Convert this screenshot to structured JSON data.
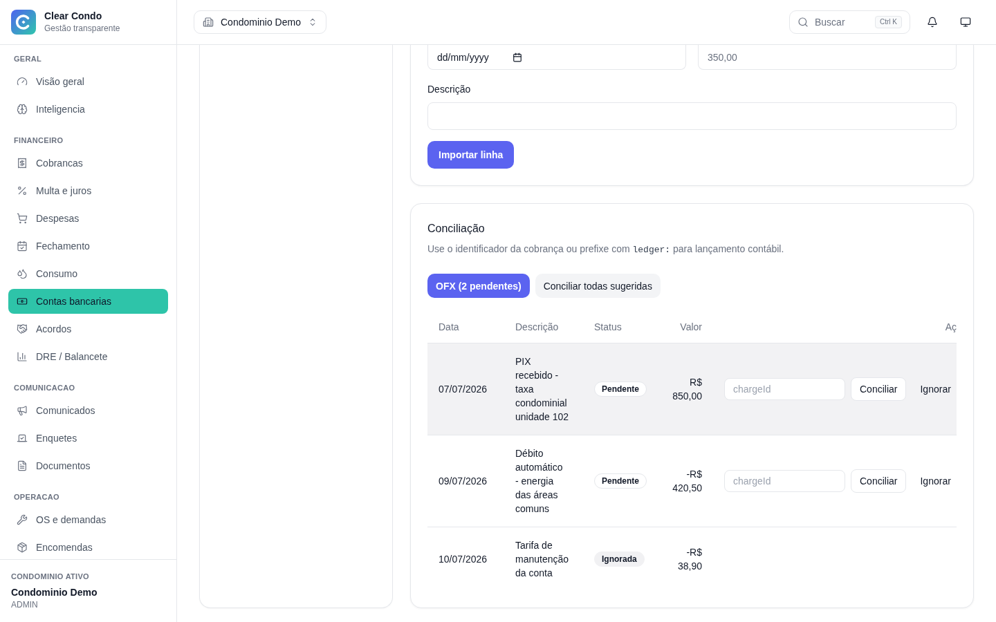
{
  "sidebar": {
    "brand": {
      "name": "Clear Condo",
      "tagline": "Gestão transparente"
    },
    "sections": [
      {
        "title": "GERAL",
        "items": [
          {
            "label": "Visão geral",
            "selected": false
          },
          {
            "label": "Inteligencia",
            "selected": false
          }
        ]
      },
      {
        "title": "FINANCEIRO",
        "items": [
          {
            "label": "Cobrancas",
            "selected": false
          },
          {
            "label": "Multa e juros",
            "selected": false
          },
          {
            "label": "Despesas",
            "selected": false
          },
          {
            "label": "Fechamento",
            "selected": false
          },
          {
            "label": "Consumo",
            "selected": false
          },
          {
            "label": "Contas bancarias",
            "selected": true
          },
          {
            "label": "Acordos",
            "selected": false
          },
          {
            "label": "DRE / Balancete",
            "selected": false
          }
        ]
      },
      {
        "title": "COMUNICACAO",
        "items": [
          {
            "label": "Comunicados",
            "selected": false
          },
          {
            "label": "Enquetes",
            "selected": false
          },
          {
            "label": "Documentos",
            "selected": false
          }
        ]
      },
      {
        "title": "OPERACAO",
        "items": [
          {
            "label": "OS e demandas",
            "selected": false
          },
          {
            "label": "Encomendas",
            "selected": false
          }
        ]
      }
    ],
    "footer": {
      "caption": "CONDOMINIO ATIVO",
      "name": "Condominio Demo",
      "role": "ADMIN"
    }
  },
  "header": {
    "condo_selector": "Condominio Demo",
    "search": {
      "placeholder": "Buscar",
      "shortcut": "Ctrl K"
    }
  },
  "import_form": {
    "date_field": {
      "placeholder": "dd/mm/yyyy"
    },
    "amount_field": {
      "placeholder": "350,00"
    },
    "description_field": {
      "label": "Descrição"
    },
    "submit_button": "Importar linha"
  },
  "reconciliation": {
    "title": "Conciliação",
    "hint": {
      "before": "Use o identificador da cobrança ou prefixe com",
      "code": "ledger:",
      "after": "para lançamento contábil."
    },
    "buttons": [
      {
        "label": "OFX (2 pendentes)",
        "kind": "primary"
      },
      {
        "label": "Conciliar todas sugeridas",
        "kind": "secondary"
      }
    ],
    "table": {
      "columns": [
        "Data",
        "Descrição",
        "Status",
        "Valor",
        "Aç"
      ],
      "rows": [
        {
          "date": "07/07/2026",
          "description_lines": [
            "PIX",
            "recebido -",
            "taxa",
            "condominial",
            "unidade 102"
          ],
          "status": {
            "label": "Pendente",
            "kind": "pending"
          },
          "amount": "R$ 850,00",
          "highlighted": true,
          "actions": {
            "charge_placeholder": "chargeId",
            "reconcile": "Conciliar",
            "ignore": "Ignorar"
          }
        },
        {
          "date": "09/07/2026",
          "description_lines": [
            "Débito",
            "automático",
            "- energia",
            "das áreas",
            "comuns"
          ],
          "status": {
            "label": "Pendente",
            "kind": "pending"
          },
          "amount": "-R$ 420,50",
          "highlighted": false,
          "actions": {
            "charge_placeholder": "chargeId",
            "reconcile": "Conciliar",
            "ignore": "Ignorar"
          }
        },
        {
          "date": "10/07/2026",
          "description_lines": [
            "Tarifa de",
            "manutenção",
            "da conta"
          ],
          "status": {
            "label": "Ignorada",
            "kind": "ignored"
          },
          "amount": "-R$ 38,90",
          "highlighted": false
        }
      ]
    }
  }
}
